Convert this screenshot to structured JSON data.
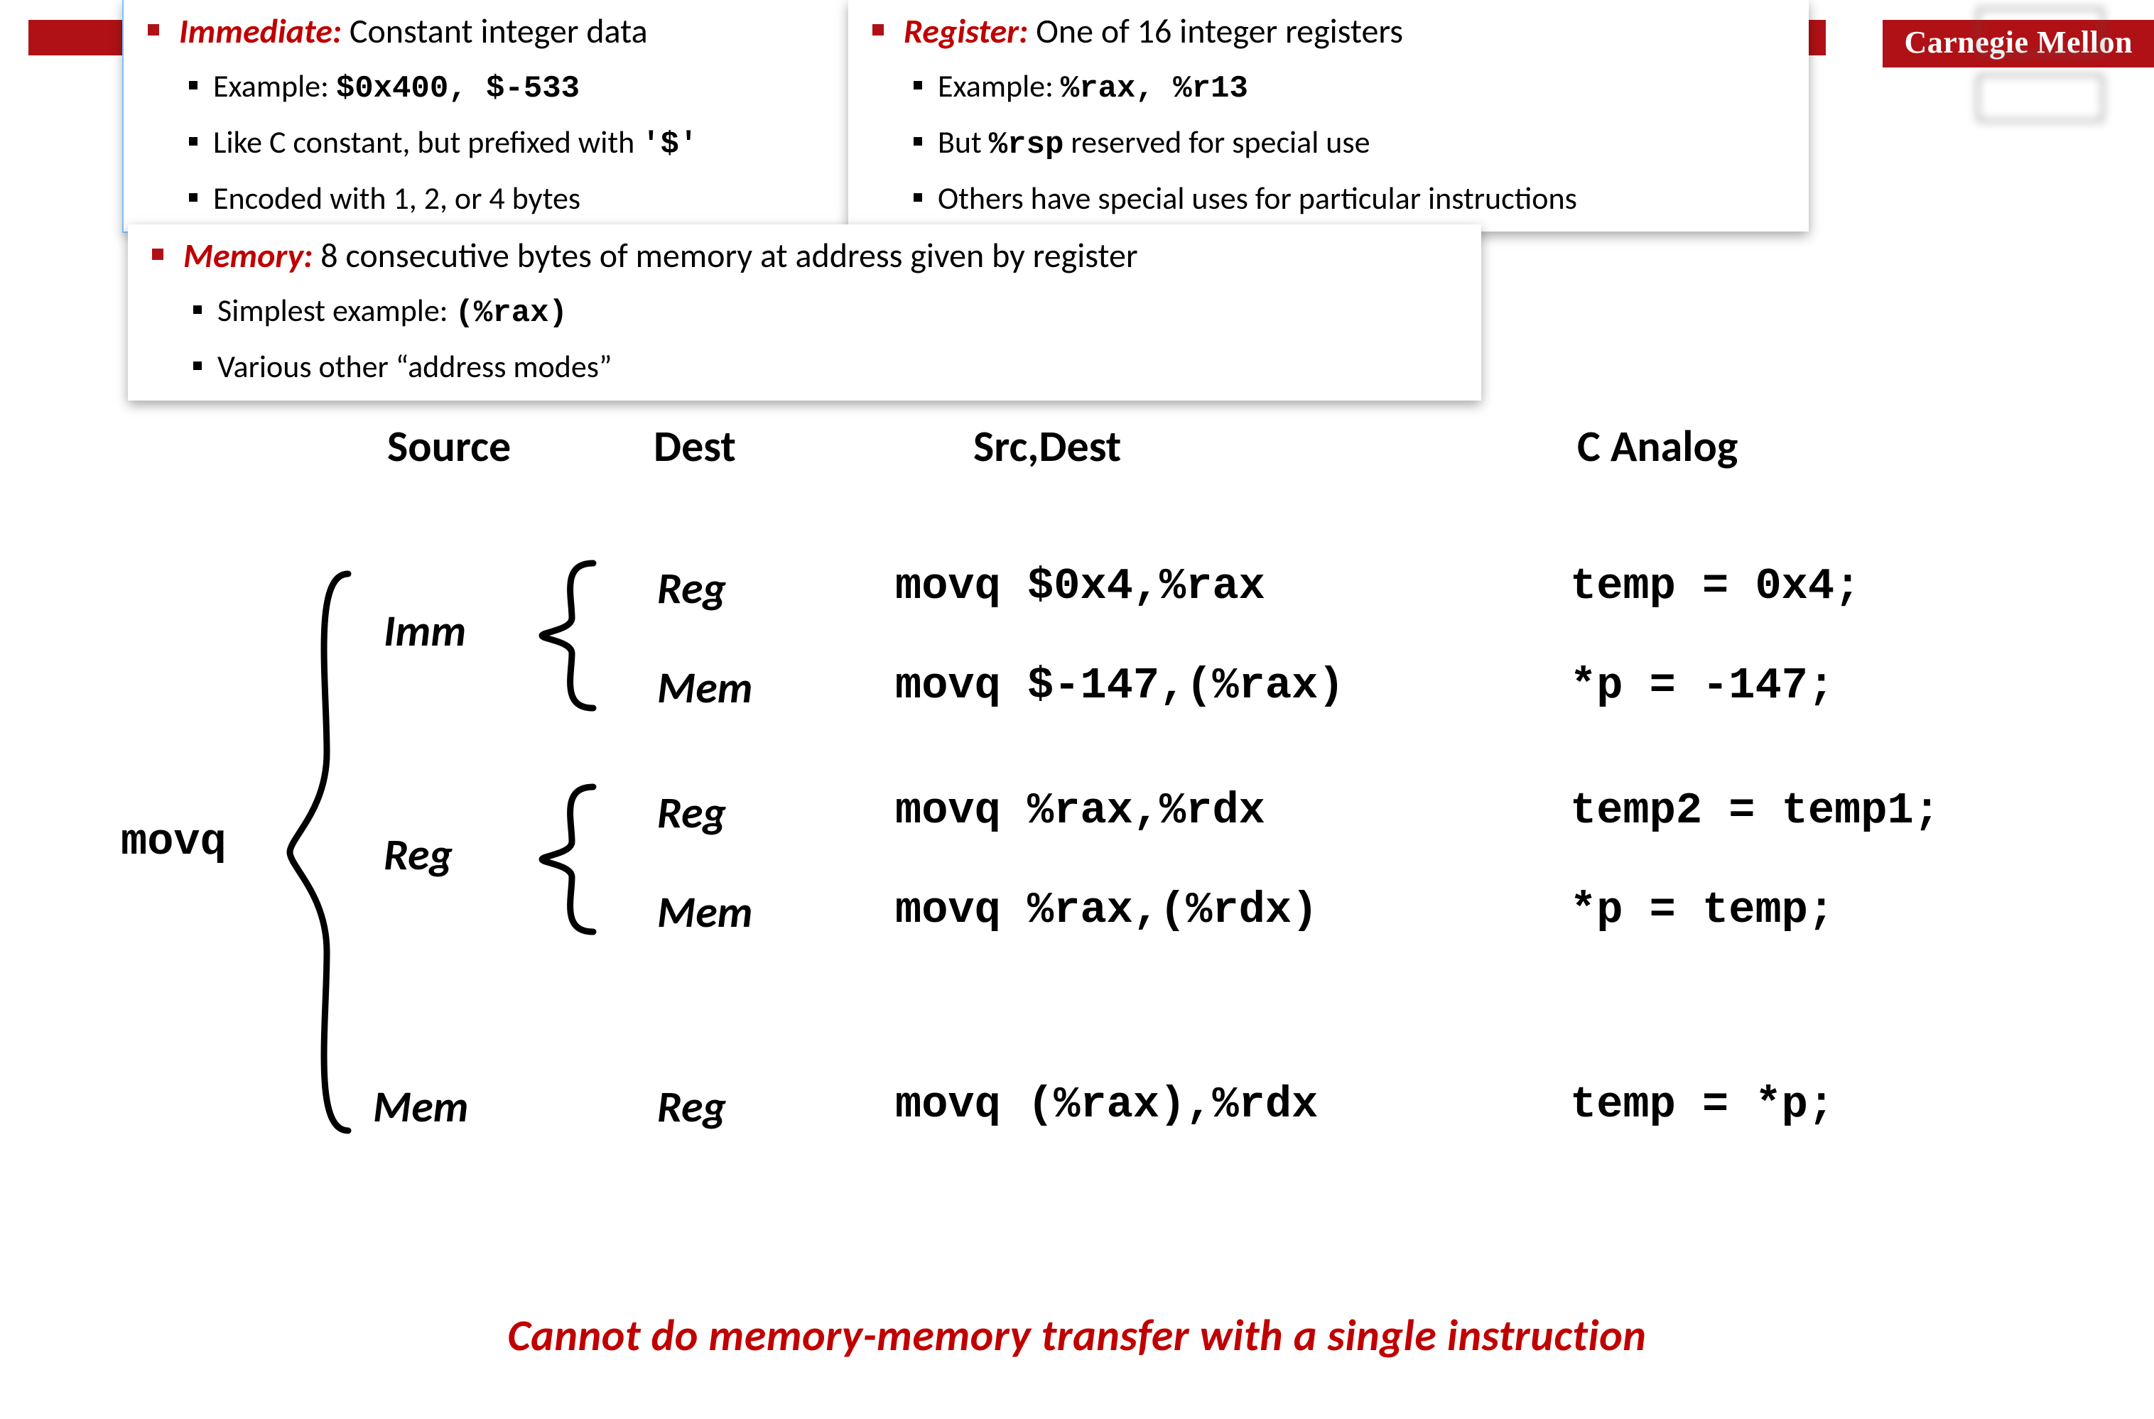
{
  "brand": "Carnegie Mellon",
  "operand_types": {
    "immediate": {
      "title": "Immediate:",
      "desc": "Constant integer data",
      "bullets": [
        {
          "prefix": "Example: ",
          "code": "$0x400, $-533"
        },
        {
          "text_a": "Like C constant, but prefixed with ",
          "code": "'$'"
        },
        {
          "text_a": "Encoded with 1, 2, or 4 bytes"
        }
      ]
    },
    "register": {
      "title": "Register:",
      "desc": "One of 16 integer registers",
      "bullets": [
        {
          "prefix": "Example: ",
          "code": "%rax,  %r13"
        },
        {
          "text_a": "But ",
          "code": "%rsp",
          "text_b": "  reserved for special use"
        },
        {
          "text_a": "Others have special uses for particular instructions"
        }
      ]
    },
    "memory": {
      "title": "Memory:",
      "desc": "8 consecutive bytes of memory at address given by register",
      "bullets": [
        {
          "prefix": "Simplest example: ",
          "code": "(%rax)"
        },
        {
          "text_a": "Various other “address modes”"
        }
      ]
    }
  },
  "columns": {
    "source": "Source",
    "dest": "Dest",
    "srcdest": "Src,Dest",
    "canalog": "C Analog"
  },
  "instr_label": "movq",
  "sources": {
    "imm": "Imm",
    "reg": "Reg",
    "mem": "Mem"
  },
  "dests": {
    "reg": "Reg",
    "mem": "Mem"
  },
  "rows": [
    {
      "src": "imm",
      "dest": "reg",
      "asm": "movq $0x4,%rax",
      "c": "temp = 0x4;"
    },
    {
      "src": "imm",
      "dest": "mem",
      "asm": "movq $-147,(%rax)",
      "c": "*p = -147;"
    },
    {
      "src": "reg",
      "dest": "reg",
      "asm": "movq %rax,%rdx",
      "c": "temp2 = temp1;"
    },
    {
      "src": "reg",
      "dest": "mem",
      "asm": "movq %rax,(%rdx)",
      "c": "*p = temp;"
    },
    {
      "src": "mem",
      "dest": "reg",
      "asm": "movq (%rax),%rdx",
      "c": "temp = *p;"
    }
  ],
  "footer": "Cannot do memory-memory transfer with a single instruction"
}
